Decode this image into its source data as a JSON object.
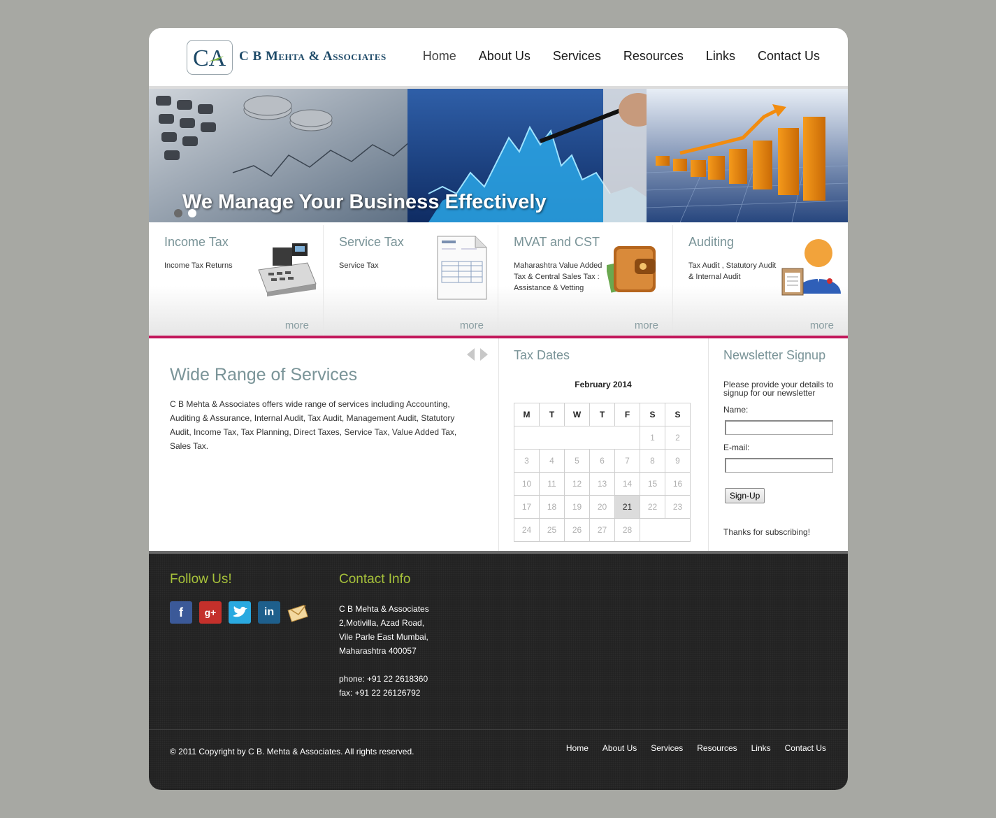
{
  "brand": {
    "logo_letters": "CA",
    "name": "C B Mehta & Associates"
  },
  "nav": [
    "Home",
    "About Us",
    "Services",
    "Resources",
    "Links",
    "Contact Us"
  ],
  "banner": {
    "caption": "We Manage Your Business Effectively",
    "slides_total": 2,
    "active_slide": 2
  },
  "services": [
    {
      "title": "Income Tax",
      "desc": "Income Tax Returns",
      "more": "more",
      "icon": "cash-register-icon"
    },
    {
      "title": "Service Tax",
      "desc": "Service Tax",
      "more": "more",
      "icon": "invoice-icon"
    },
    {
      "title": "MVAT and CST",
      "desc": "Maharashtra Value Added Tax & Central Sales Tax : Assistance & Vetting",
      "more": "more",
      "icon": "wallet-icon"
    },
    {
      "title": "Auditing",
      "desc": "Tax Audit , Statutory Audit & Internal Audit",
      "more": "more",
      "icon": "auditor-icon"
    }
  ],
  "main": {
    "title": "Wide Range of Services",
    "text": "C B Mehta & Associates offers wide range of services including Accounting, Auditing & Assurance, Internal Audit, Tax Audit, Management Audit, Statutory Audit, Income Tax, Tax Planning, Direct Taxes, Service Tax, Value Added Tax, Sales Tax."
  },
  "tax_dates": {
    "title": "Tax Dates",
    "month": "February  2014",
    "weekdays": [
      "M",
      "T",
      "W",
      "T",
      "F",
      "S",
      "S"
    ],
    "weeks": [
      [
        "",
        "",
        "",
        "",
        "",
        "1",
        "2"
      ],
      [
        "3",
        "4",
        "5",
        "6",
        "7",
        "8",
        "9"
      ],
      [
        "10",
        "11",
        "12",
        "13",
        "14",
        "15",
        "16"
      ],
      [
        "17",
        "18",
        "19",
        "20",
        "21",
        "22",
        "23"
      ],
      [
        "24",
        "25",
        "26",
        "27",
        "28",
        "",
        ""
      ]
    ],
    "today": "21"
  },
  "newsletter": {
    "title": "Newsletter Signup",
    "text": "Please provide your details to signup for our newsletter",
    "name_label": "Name:",
    "email_label": "E-mail:",
    "name_value": "",
    "email_value": "",
    "button": "Sign-Up",
    "thanks": "Thanks for subscribing!"
  },
  "footer": {
    "follow_title": "Follow Us!",
    "social": [
      "facebook-icon",
      "google-plus-icon",
      "twitter-icon",
      "linkedin-icon",
      "email-icon"
    ],
    "contact_title": "Contact Info",
    "contact_lines": [
      "C B Mehta & Associates",
      "2,Motivilla, Azad Road,",
      "Vile Parle East Mumbai,",
      "Maharashtra 400057",
      "",
      "phone: +91 22 2618360",
      "fax: +91 22 26126792"
    ],
    "copyright": "© 2011 Copyright by C B. Mehta & Associates. All rights reserved.",
    "nav": [
      "Home",
      "About Us",
      "Services",
      "Resources",
      "Links",
      "Contact Us"
    ]
  },
  "colors": {
    "accent_magenta": "#c2185b",
    "heading_grey": "#7a9498",
    "footer_green": "#a6c13a",
    "brand_blue": "#1e4a68"
  }
}
